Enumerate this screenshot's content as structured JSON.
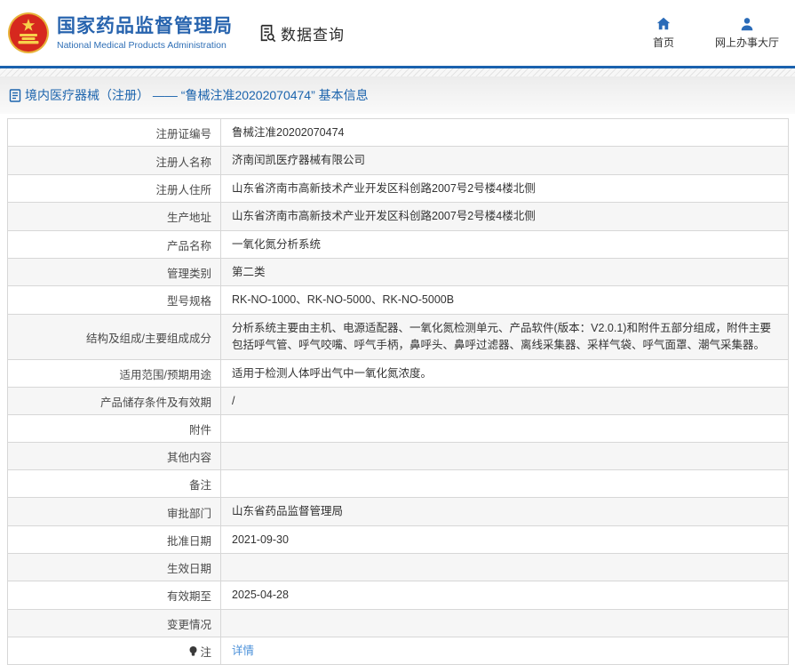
{
  "header": {
    "org_name_zh": "国家药品监督管理局",
    "org_name_en": "National Medical Products Administration",
    "data_query_label": "数据查询",
    "nav": [
      {
        "label": "首页",
        "icon": "home-icon"
      },
      {
        "label": "网上办事大厅",
        "icon": "user-icon"
      }
    ]
  },
  "breadcrumb": {
    "text": "境内医疗器械（注册） —— “鲁械注准20202070474” 基本信息"
  },
  "table": {
    "rows": [
      {
        "label": "注册证编号",
        "value": "鲁械注准20202070474"
      },
      {
        "label": "注册人名称",
        "value": "济南闰凯医疗器械有限公司"
      },
      {
        "label": "注册人住所",
        "value": "山东省济南市高新技术产业开发区科创路2007号2号楼4楼北侧"
      },
      {
        "label": "生产地址",
        "value": "山东省济南市高新技术产业开发区科创路2007号2号楼4楼北侧"
      },
      {
        "label": "产品名称",
        "value": "一氧化氮分析系统"
      },
      {
        "label": "管理类别",
        "value": "第二类"
      },
      {
        "label": "型号规格",
        "value": "RK-NO-1000、RK-NO-5000、RK-NO-5000B"
      },
      {
        "label": "结构及组成/主要组成成分",
        "value": "分析系统主要由主机、电源适配器、一氧化氮检测单元、产品软件(版本：V2.0.1)和附件五部分组成，附件主要包括呼气管、呼气咬嘴、呼气手柄，鼻呼头、鼻呼过滤器、离线采集器、采样气袋、呼气面罩、潮气采集器。",
        "tall": true
      },
      {
        "label": "适用范围/预期用途",
        "value": "适用于检测人体呼出气中一氧化氮浓度。"
      },
      {
        "label": "产品储存条件及有效期",
        "value": "/"
      },
      {
        "label": "附件",
        "value": ""
      },
      {
        "label": "其他内容",
        "value": ""
      },
      {
        "label": "备注",
        "value": ""
      },
      {
        "label": "审批部门",
        "value": "山东省药品监督管理局"
      },
      {
        "label": "批准日期",
        "value": "2021-09-30"
      },
      {
        "label": "生效日期",
        "value": ""
      },
      {
        "label": "有效期至",
        "value": "2025-04-28"
      },
      {
        "label": "变更情况",
        "value": ""
      },
      {
        "label": "注",
        "label_icon": "bulb-icon",
        "link_label": "详情"
      }
    ]
  },
  "colors": {
    "brand_blue": "#2864ae",
    "header_rule_blue": "#1a62ae",
    "breadcrumb_blue": "#1c64ad",
    "link_blue": "#4a90d9",
    "alt_row_gray": "#f6f6f6",
    "border_gray": "#d7d7d7"
  }
}
